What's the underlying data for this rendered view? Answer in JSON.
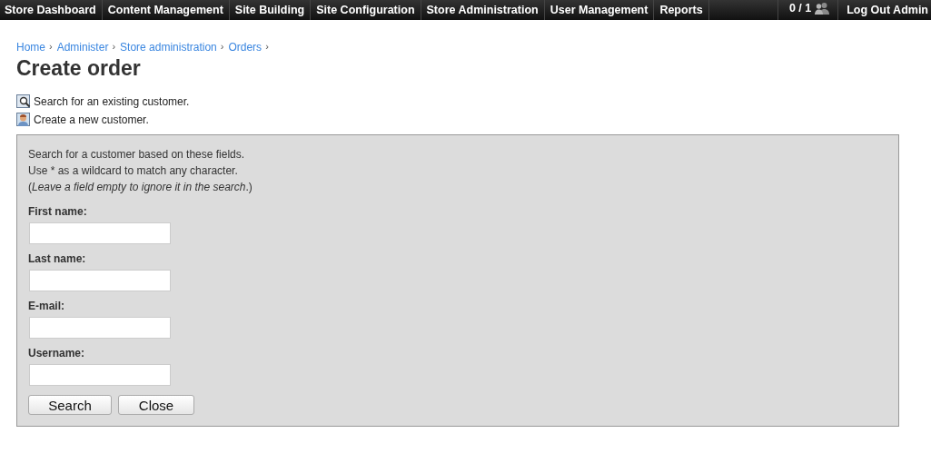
{
  "nav": {
    "items": [
      {
        "label": "Store Dashboard"
      },
      {
        "label": "Content Management"
      },
      {
        "label": "Site Building"
      },
      {
        "label": "Site Configuration"
      },
      {
        "label": "Store Administration"
      },
      {
        "label": "User Management"
      },
      {
        "label": "Reports"
      }
    ],
    "users_online": "0 / 1",
    "logout": "Log Out Admin"
  },
  "breadcrumb": [
    {
      "label": "Home",
      "sep": "›"
    },
    {
      "label": "Administer",
      "sep": "›"
    },
    {
      "label": "Store administration",
      "sep": "›"
    },
    {
      "label": "Orders",
      "sep": "›"
    }
  ],
  "title": "Create order",
  "actions": [
    {
      "kind": "search",
      "label": "Search for an existing customer."
    },
    {
      "kind": "person",
      "label": "Create a new customer."
    }
  ],
  "panel": {
    "intro": [
      "Search for a customer based on these fields.",
      "Use * as a wildcard to match any character.",
      "(*Leave a field empty to ignore it in the search*.)"
    ],
    "fields": [
      {
        "label": "First name:"
      },
      {
        "label": "Last name:"
      },
      {
        "label": "E-mail:"
      },
      {
        "label": "Username:"
      }
    ],
    "buttons": [
      "Search",
      "Close"
    ]
  }
}
